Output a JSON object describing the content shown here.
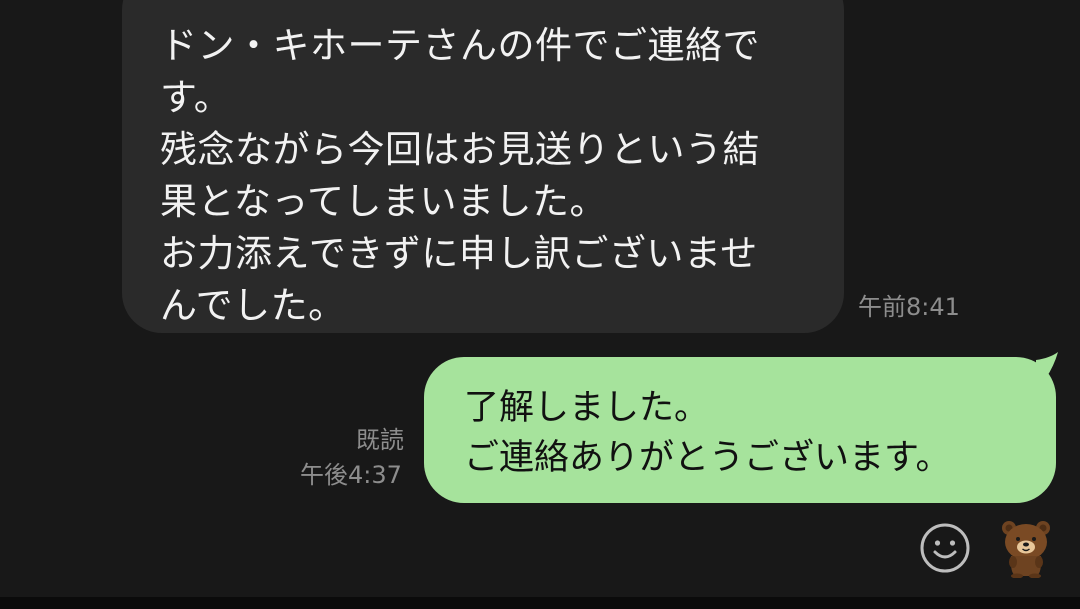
{
  "incoming_message": {
    "lines": [
      "ドン・キホーテさんの件でご連絡で",
      "す。",
      "残念ながら今回はお見送りという結",
      "果となってしまいました。",
      "お力添えできずに申し訳ございませ",
      "んでした。"
    ],
    "time": "午前8:41"
  },
  "outgoing_message": {
    "lines": [
      "了解しました。",
      "ご連絡ありがとうございます。"
    ],
    "read_status": "既読",
    "time": "午後4:37"
  },
  "actions": {
    "emoji_icon": "smiley-icon",
    "sticker_icon": "bear-sticker-icon"
  },
  "colors": {
    "background": "#181818",
    "incoming_bubble": "#2a2a2a",
    "outgoing_bubble": "#a6e39c",
    "meta_text": "#8d8d8d"
  }
}
